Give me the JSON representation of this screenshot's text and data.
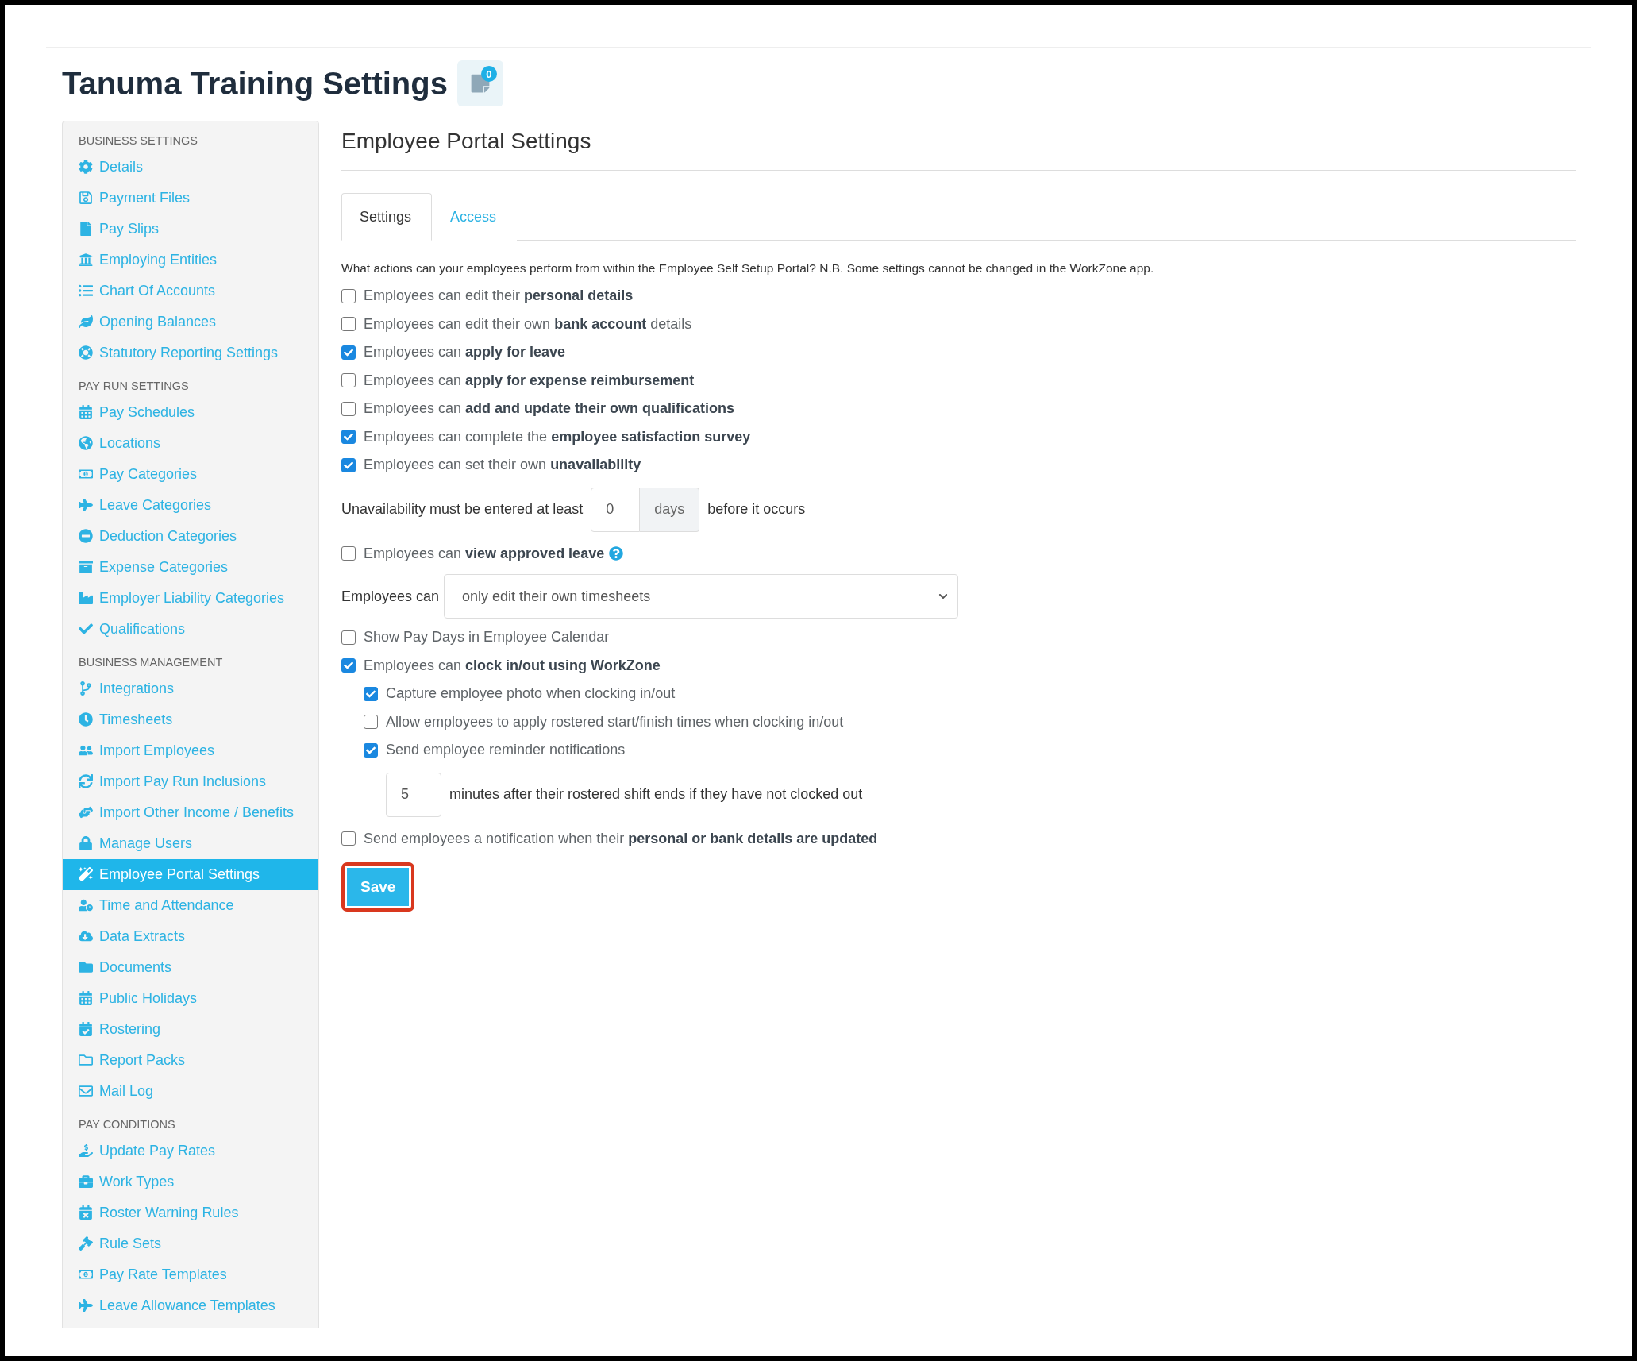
{
  "page": {
    "title": "Tanuma Training Settings",
    "notification_count": "0"
  },
  "sidebar": {
    "sections": [
      {
        "heading": "BUSINESS SETTINGS",
        "items": [
          {
            "label": "Details",
            "selected": false
          },
          {
            "label": "Payment Files",
            "selected": false
          },
          {
            "label": "Pay Slips",
            "selected": false
          },
          {
            "label": "Employing Entities",
            "selected": false
          },
          {
            "label": "Chart Of Accounts",
            "selected": false
          },
          {
            "label": "Opening Balances",
            "selected": false
          },
          {
            "label": "Statutory Reporting Settings",
            "selected": false
          }
        ]
      },
      {
        "heading": "PAY RUN SETTINGS",
        "items": [
          {
            "label": "Pay Schedules",
            "selected": false
          },
          {
            "label": "Locations",
            "selected": false
          },
          {
            "label": "Pay Categories",
            "selected": false
          },
          {
            "label": "Leave Categories",
            "selected": false
          },
          {
            "label": "Deduction Categories",
            "selected": false
          },
          {
            "label": "Expense Categories",
            "selected": false
          },
          {
            "label": "Employer Liability Categories",
            "selected": false
          },
          {
            "label": "Qualifications",
            "selected": false
          }
        ]
      },
      {
        "heading": "BUSINESS MANAGEMENT",
        "items": [
          {
            "label": "Integrations",
            "selected": false
          },
          {
            "label": "Timesheets",
            "selected": false
          },
          {
            "label": "Import Employees",
            "selected": false
          },
          {
            "label": "Import Pay Run Inclusions",
            "selected": false
          },
          {
            "label": "Import Other Income / Benefits",
            "selected": false
          },
          {
            "label": "Manage Users",
            "selected": false
          },
          {
            "label": "Employee Portal Settings",
            "selected": true
          },
          {
            "label": "Time and Attendance",
            "selected": false
          },
          {
            "label": "Data Extracts",
            "selected": false
          },
          {
            "label": "Documents",
            "selected": false
          },
          {
            "label": "Public Holidays",
            "selected": false
          },
          {
            "label": "Rostering",
            "selected": false
          },
          {
            "label": "Report Packs",
            "selected": false
          },
          {
            "label": "Mail Log",
            "selected": false
          }
        ]
      },
      {
        "heading": "PAY CONDITIONS",
        "items": [
          {
            "label": "Update Pay Rates",
            "selected": false
          },
          {
            "label": "Work Types",
            "selected": false
          },
          {
            "label": "Roster Warning Rules",
            "selected": false
          },
          {
            "label": "Rule Sets",
            "selected": false
          },
          {
            "label": "Pay Rate Templates",
            "selected": false
          },
          {
            "label": "Leave Allowance Templates",
            "selected": false
          }
        ]
      }
    ]
  },
  "main": {
    "heading": "Employee Portal Settings",
    "tabs": [
      {
        "label": "Settings",
        "selected": true
      },
      {
        "label": "Access",
        "selected": false
      }
    ],
    "description": "What actions can your employees perform from within the Employee Self Setup Portal? N.B. Some settings cannot be changed in the WorkZone app.",
    "options": [
      {
        "kind": "checkbox",
        "label": "Employees can edit their **personal details**",
        "checked": false
      },
      {
        "kind": "checkbox",
        "label": "Employees can edit their own **bank account** details",
        "checked": false
      },
      {
        "kind": "checkbox",
        "label": "Employees can **apply for leave**",
        "checked": true
      },
      {
        "kind": "checkbox",
        "label": "Employees can **apply for expense reimbursement**",
        "checked": false
      },
      {
        "kind": "checkbox",
        "label": "Employees can **add and update their own qualifications**",
        "checked": false
      },
      {
        "kind": "checkbox",
        "label": "Employees can complete the **employee satisfaction survey**",
        "checked": true
      },
      {
        "kind": "checkbox",
        "label": "Employees can set their own **unavailability**",
        "checked": true
      },
      {
        "kind": "number",
        "before": "Unavailability must be entered at least",
        "value": "0",
        "unit": "days",
        "after": "before it occurs"
      },
      {
        "kind": "checkbox",
        "label": "Employees can **view approved leave**",
        "checked": false,
        "help": true
      },
      {
        "kind": "select",
        "label": "Employees can",
        "value": "only edit their own timesheets"
      },
      {
        "kind": "checkbox",
        "label": "Show Pay Days in Employee Calendar",
        "checked": false
      },
      {
        "kind": "checkbox",
        "label": "Employees can **clock in/out using WorkZone**",
        "checked": true,
        "children": [
          {
            "kind": "checkbox",
            "label": "Capture employee photo when clocking in/out",
            "checked": true
          },
          {
            "kind": "checkbox",
            "label": "Allow employees to apply rostered start/finish times when clocking in/out",
            "checked": false
          },
          {
            "kind": "checkbox",
            "label": "Send employee reminder notifications",
            "checked": true
          },
          {
            "kind": "number",
            "value": "5",
            "after": "minutes after their rostered shift ends if they have not clocked out"
          }
        ]
      },
      {
        "kind": "checkbox",
        "label": "Send employees a notification when their **personal or bank details are updated**",
        "checked": false
      }
    ],
    "save_button": {
      "label": "Save",
      "highlighted": true
    }
  }
}
